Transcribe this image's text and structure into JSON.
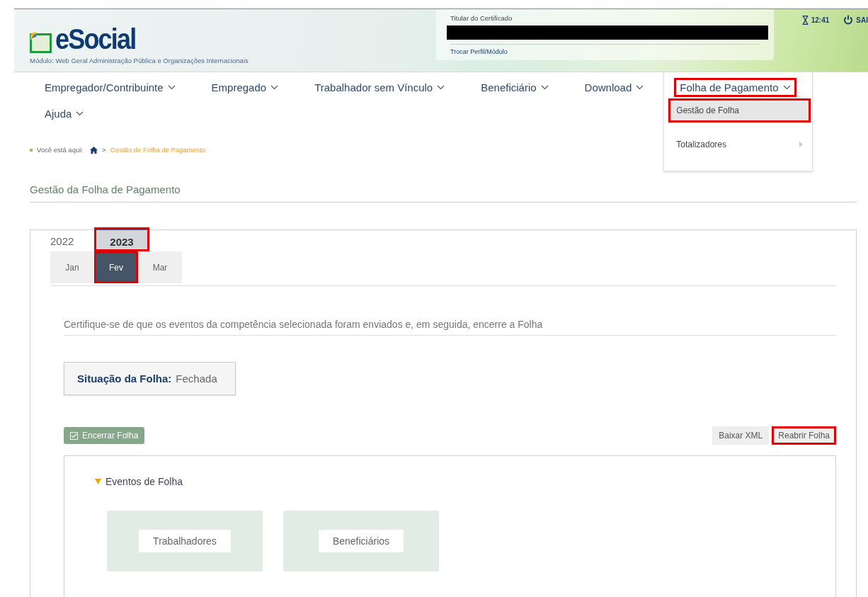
{
  "header": {
    "logo": "eSocial",
    "module": "Módulo: Web Geral Administração Pública e Organizações Internacionais",
    "certificate_label": "Titular do Certificado",
    "switch_link": "Trocar Perfil/Módulo",
    "time": "12:41",
    "logout": "SAI"
  },
  "nav": [
    {
      "label": "Empregador/Contribuinte",
      "highlighted": false
    },
    {
      "label": "Empregado",
      "highlighted": false
    },
    {
      "label": "Trabalhador sem Vínculo",
      "highlighted": false
    },
    {
      "label": "Beneficiário",
      "highlighted": false
    },
    {
      "label": "Download",
      "highlighted": false
    },
    {
      "label": "Folha de Pagamento",
      "highlighted": true
    },
    {
      "label": "Ajuda",
      "highlighted": false
    }
  ],
  "dropdown": [
    {
      "label": "Gestão de Folha",
      "selected": true,
      "highlighted": true,
      "has_submenu": false
    },
    {
      "label": "Totalizadores",
      "selected": false,
      "highlighted": false,
      "has_submenu": true
    }
  ],
  "breadcrumb": {
    "label": "Você está aqui:",
    "separator": ">",
    "current": "Gestão de Folha de Pagamento"
  },
  "page_title": "Gestão da Folha de Pagamento",
  "year_tabs": [
    {
      "label": "2022",
      "selected": false,
      "highlighted": false
    },
    {
      "label": "2023",
      "selected": true,
      "highlighted": true
    }
  ],
  "month_tabs": [
    {
      "label": "Jan",
      "selected": false,
      "highlighted": false
    },
    {
      "label": "Fev",
      "selected": true,
      "highlighted": true
    },
    {
      "label": "Mar",
      "selected": false,
      "highlighted": false
    }
  ],
  "instruction": "Certifique-se de que os eventos da competência selecionada foram enviados e, em seguida, encerre a Folha",
  "status": {
    "label": "Situação da Folha:",
    "value": "Fechada"
  },
  "actions": [
    {
      "label": "Encerrar Folha",
      "kind": "primary",
      "highlighted": false
    },
    {
      "label": "Baixar XML",
      "kind": "secondary",
      "highlighted": false
    },
    {
      "label": "Reabrir Folha",
      "kind": "secondary",
      "highlighted": true
    }
  ],
  "events": {
    "title": "Eventos de Folha",
    "expanded": true,
    "cards": [
      "Trabalhadores",
      "Beneficiários"
    ]
  }
}
